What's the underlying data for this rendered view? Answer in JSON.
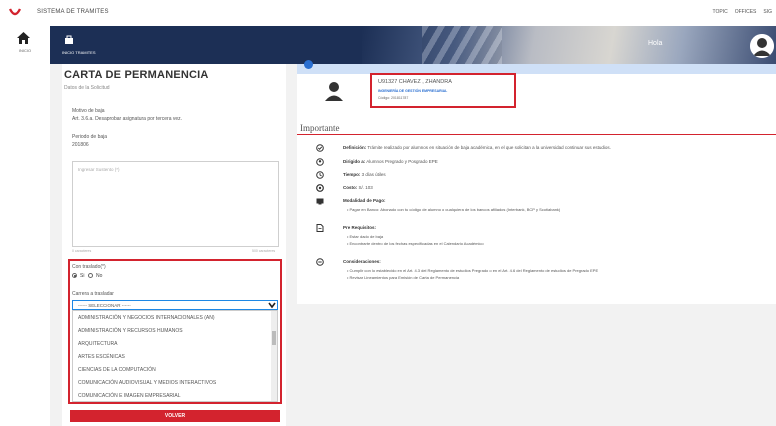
{
  "app": {
    "title": "SISTEMA DE TRAMITES",
    "top_links": [
      "TOPIC",
      "OFFICES",
      "SIG"
    ]
  },
  "rail": {
    "home_label": "INICIO"
  },
  "band": {
    "tab_label": "INICIO TRAMITES",
    "greeting": "Hola"
  },
  "form": {
    "title": "CARTA DE PERMANENCIA",
    "subtitle": "Datos de la Solicitud",
    "motivo_label": "Motivo de baja",
    "motivo_value": "Art. 3.6.a. Desaprobar asignatura por tercera vez.",
    "periodo_label": "Periodo de baja",
    "periodo_value": "201806",
    "textarea_placeholder": "Ingresar Sustento (*)",
    "counter_left": "0 caracteres",
    "counter_right": "500 caracteres",
    "traslado_label": "Con traslado(*)",
    "radio_yes": "Si",
    "radio_no": "No",
    "carrera_label": "Carrera a trasladar",
    "select_value": "------ SELECCIONAR ------",
    "options": [
      "ADMINISTRACIÓN Y NEGOCIOS INTERNACIONALES (AN)",
      "ADMINISTRACIÓN Y RECURSOS HUMANOS",
      "ARQUITECTURA",
      "ARTES ESCÉNICAS",
      "CIENCIAS DE LA COMPUTACIÓN",
      "COMUNICACIÓN AUDIOVISUAL Y MEDIOS INTERACTIVOS",
      "COMUNICACIÓN E IMAGEN EMPRESARIAL"
    ],
    "submit": "VOLVER"
  },
  "profile": {
    "name": "U91327     CHAVEZ , ZHANDRA",
    "career": "INGENIERÍA DE GESTIÓN EMPRESARIAL",
    "code": "Código: 201811787"
  },
  "important": {
    "title": "Importante",
    "items": [
      {
        "icon": "check-circle-icon",
        "label": "Definición:",
        "text": " Trámite realizado por alumnos en situación de baja académica, en el que solicitan a la universidad continuar sus estudios."
      },
      {
        "icon": "user-circle-icon",
        "label": "Dirigido a:",
        "text": " Alumnos Pregrado y Posgrado EPE"
      },
      {
        "icon": "clock-icon",
        "label": "Tiempo:",
        "text": " 3 días útiles"
      },
      {
        "icon": "coin-icon",
        "label": "Costo:",
        "text": " S/. 103"
      },
      {
        "icon": "payment-icon",
        "label": "Modalidad de Pago:",
        "text": ""
      },
      {
        "icon": "document-icon",
        "label": "Pre Requisitos:",
        "text": ""
      },
      {
        "icon": "info-circle-icon",
        "label": "Consideraciones:",
        "text": ""
      }
    ],
    "payment_bullets": [
      "Pagar en Banco: Abonado con tu código de alumno o cualquiera de los bancos afiliados (Interbank, BCP y Scotiabank)"
    ],
    "prereq_bullets": [
      "Estar dado de baja",
      "Encontrarte dentro de los fechas especificadas en el Calendario Académico"
    ],
    "consider_bullets": [
      "Cumplir con lo establecido en el Art. 4.3 del Reglamento de estudios Pregrado o en el Art. 4.6 del Reglamento de estudios de Pregrado EPE",
      "Revisar Lineamientos para Emisión de Carta de Permanencia"
    ]
  }
}
